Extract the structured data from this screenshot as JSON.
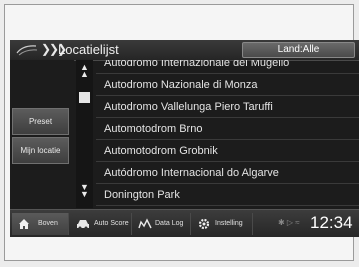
{
  "header": {
    "title": "Locatielijst",
    "land_button": "Land:Alle"
  },
  "sidebar": {
    "preset": "Preset",
    "my_location": "Mijn locatie"
  },
  "list": {
    "items": [
      "Autodromo Internazionale del Mugello",
      "Autodromo Nazionale di Monza",
      "Autodromo Vallelunga Piero Taruffi",
      "Automotodrom Brno",
      "Automotodrom Grobnik",
      "Autódromo Internacional do Algarve",
      "Donington Park"
    ]
  },
  "tabs": [
    {
      "label": "Boven",
      "icon": "home-icon"
    },
    {
      "label": "Auto Score",
      "icon": "car-icon"
    },
    {
      "label": "Data Log",
      "icon": "track-log-icon"
    },
    {
      "label": "Instelling",
      "icon": "gear-icon"
    }
  ],
  "status": {
    "time": "12:34"
  }
}
